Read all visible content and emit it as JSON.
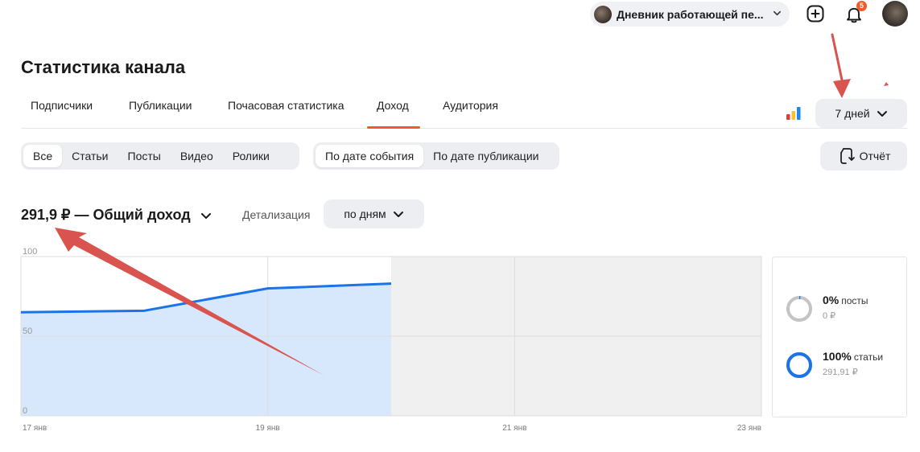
{
  "header": {
    "channel_name": "Дневник работающей пе...",
    "notification_count": "5"
  },
  "page": {
    "title": "Статистика канала"
  },
  "tabs": [
    {
      "label": "Подписчики"
    },
    {
      "label": "Публикации"
    },
    {
      "label": "Почасовая статистика"
    },
    {
      "label": "Доход"
    },
    {
      "label": "Аудитория"
    }
  ],
  "active_tab": "Доход",
  "period": {
    "label": "7 дней"
  },
  "content_filter": {
    "options": [
      "Все",
      "Статьи",
      "Посты",
      "Видео",
      "Ролики"
    ],
    "selected": "Все"
  },
  "date_filter": {
    "options": [
      "По дате события",
      "По дате публикации"
    ],
    "selected": "По дате события"
  },
  "report": {
    "label": "Отчёт"
  },
  "summary": {
    "total": "291,9 ₽ — Общий доход",
    "detail_label": "Детализация",
    "detail_value": "по дням"
  },
  "chart_data": {
    "type": "area",
    "x": [
      "17 янв",
      "18 янв",
      "19 янв",
      "20 янв",
      "21 янв",
      "22 янв",
      "23 янв"
    ],
    "x_tick_labels": [
      "17 янв",
      "19 янв",
      "21 янв",
      "23 янв"
    ],
    "y_tick_labels": [
      "100",
      "50",
      "0"
    ],
    "ylim": [
      0,
      100
    ],
    "series": [
      {
        "values": [
          65,
          66,
          80,
          83
        ]
      }
    ],
    "future_region_from": "20 янв",
    "grid": true,
    "color": "#1a73e8",
    "fill_color": "#d7e8fc"
  },
  "legend": [
    {
      "pct": "0%",
      "name": "посты",
      "amount": "0 ₽",
      "fraction": 0.0,
      "color": "#c4c4c4"
    },
    {
      "pct": "100%",
      "name": "статьи",
      "amount": "291,91 ₽",
      "fraction": 1.0,
      "color": "#1a73e8"
    }
  ],
  "colors": {
    "accent": "#f05a28",
    "chart_line": "#1a73e8",
    "annotation_arrow": "#d9534f"
  },
  "icons": {
    "add": "plus-square-icon",
    "notifications": "bell-icon",
    "period_chevron": "chevron-down-icon",
    "report": "report-refresh-icon",
    "stats": "colored-bars-icon"
  }
}
